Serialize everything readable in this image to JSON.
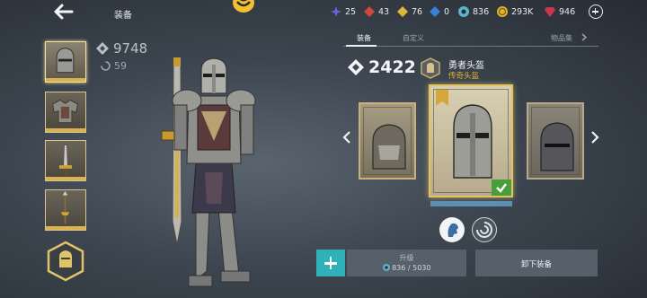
{
  "header": {
    "title": "装备",
    "back_icon": "back-arrow-icon",
    "logo_icon": "emblem-logo-icon"
  },
  "resources": [
    {
      "name": "purple-shard",
      "value": "25",
      "color": "#6f63d8"
    },
    {
      "name": "red-gem",
      "value": "43",
      "color": "#d2473b"
    },
    {
      "name": "yellow-gem",
      "value": "76",
      "color": "#e0b53a"
    },
    {
      "name": "blue-gem",
      "value": "0",
      "color": "#3a7fd6"
    },
    {
      "name": "sigil-currency",
      "value": "836",
      "color": "#5ab5c9"
    },
    {
      "name": "gold-coin",
      "value": "293K",
      "color": "#e1b233"
    },
    {
      "name": "ruby",
      "value": "946",
      "color": "#c8374a"
    }
  ],
  "left_stats": {
    "power": "9748",
    "secondary": "59"
  },
  "tabs": [
    {
      "label": "装备",
      "active": true
    },
    {
      "label": "自定义",
      "active": false
    },
    {
      "label": "物品集",
      "active": false
    }
  ],
  "selected_item": {
    "power": "2422",
    "name": "勇者头盔",
    "rarity": "传奇头盔"
  },
  "upgrade": {
    "label": "升级",
    "cost_current": "836",
    "cost_total": "5030",
    "separator": " / "
  },
  "unequip": {
    "label": "卸下装备"
  },
  "colors": {
    "accent_teal": "#2fb1b7",
    "legendary_gold": "#e6b33b"
  }
}
